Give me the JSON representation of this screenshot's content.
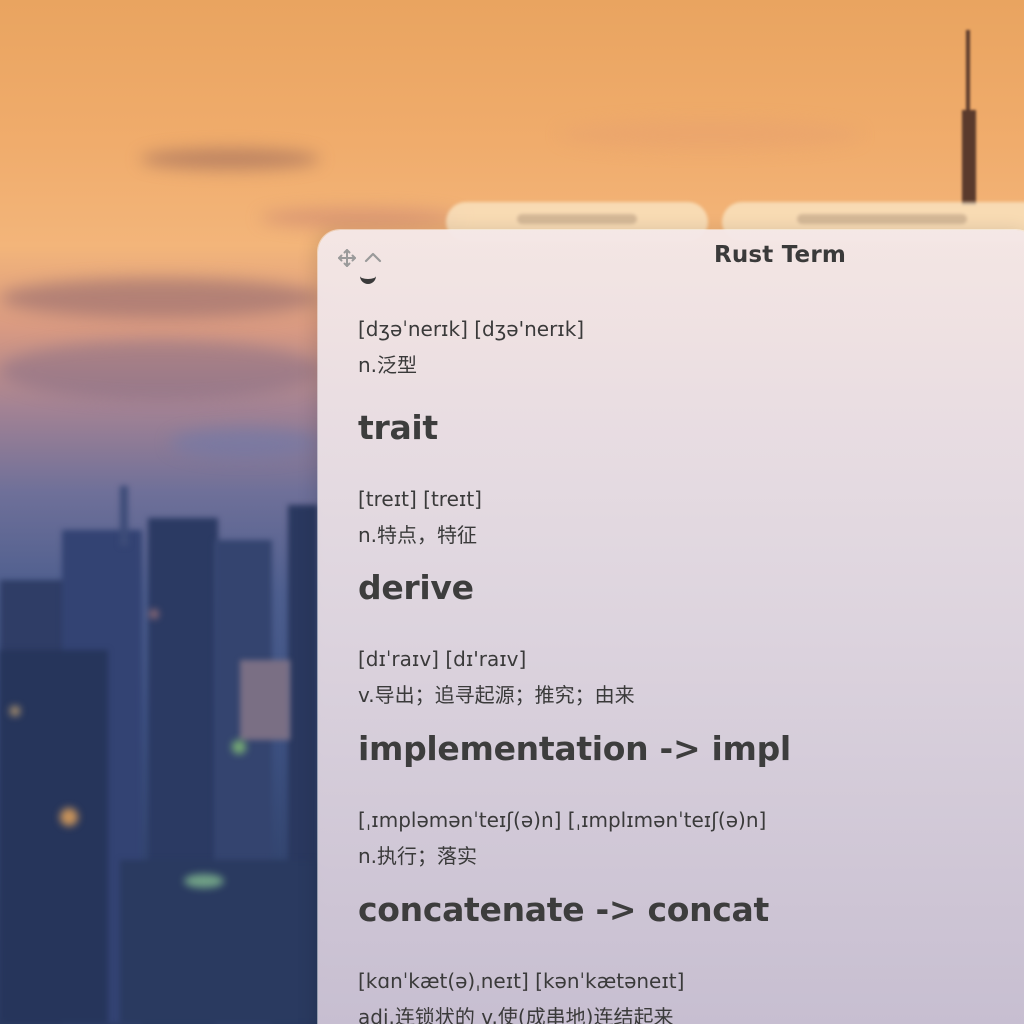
{
  "window": {
    "title": "Rust Term"
  },
  "icons": {
    "move": "move-icon",
    "collapse": "chevron-up-icon"
  },
  "entries": [
    {
      "word": "generic",
      "phonetic": "[dʒəˈnerɪk] [dʒə'nerɪk]",
      "meaning": "n.泛型"
    },
    {
      "word": "trait",
      "phonetic": "[treɪt] [treɪt]",
      "meaning": "n.特点，特征"
    },
    {
      "word": "derive",
      "phonetic": "[dɪˈraɪv] [dɪ'raɪv]",
      "meaning": "v.导出；追寻起源；推究；由来"
    },
    {
      "word": "implementation -> impl",
      "phonetic": "[ˌɪmpləmənˈteɪʃ(ə)n] [ˌɪmplɪmənˈteɪʃ(ə)n]",
      "meaning": "n.执行；落实"
    },
    {
      "word": "concatenate -> concat",
      "phonetic": "[kɑnˈkæt(ə)ˌneɪt] [kənˈkætəneɪt]",
      "meaning": "adj.连锁状的 v.使(成串地)连结起来"
    }
  ]
}
